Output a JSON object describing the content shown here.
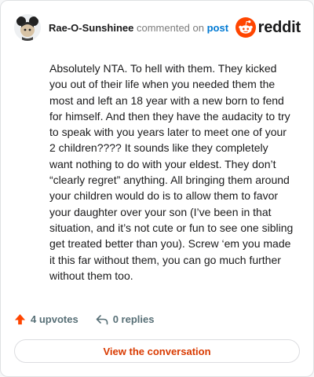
{
  "comment": {
    "username": "Rae-O-Sunshinee",
    "action_text": "commented on",
    "post_link": "post",
    "body": "Absolutely NTA. To hell with them. They kicked you out of their life when you needed them the most and left an 18 year with a new born to fend for himself. And then they have the audacity to try to speak with you years later to meet one of your 2 children???? It sounds like they completely want nothing to do with your eldest. They don’t “clearly regret” anything. All bringing them around your children would do is to allow them to favor your daughter over your son (I’ve been in that situation, and it’s not cute or fun to see one sibling get treated better than you). Screw ‘em you made it this far without them, you can go much further without them too."
  },
  "brand": {
    "name": "reddit",
    "color": "#ff4500"
  },
  "stats": {
    "upvotes": "4 upvotes",
    "replies": "0 replies"
  },
  "cta": {
    "label": "View the conversation"
  },
  "icons": {
    "avatar": "mouse-ears-avatar",
    "logo": "reddit-snoo-icon",
    "upvote": "upvote-arrow-icon",
    "reply": "reply-arrow-icon"
  }
}
